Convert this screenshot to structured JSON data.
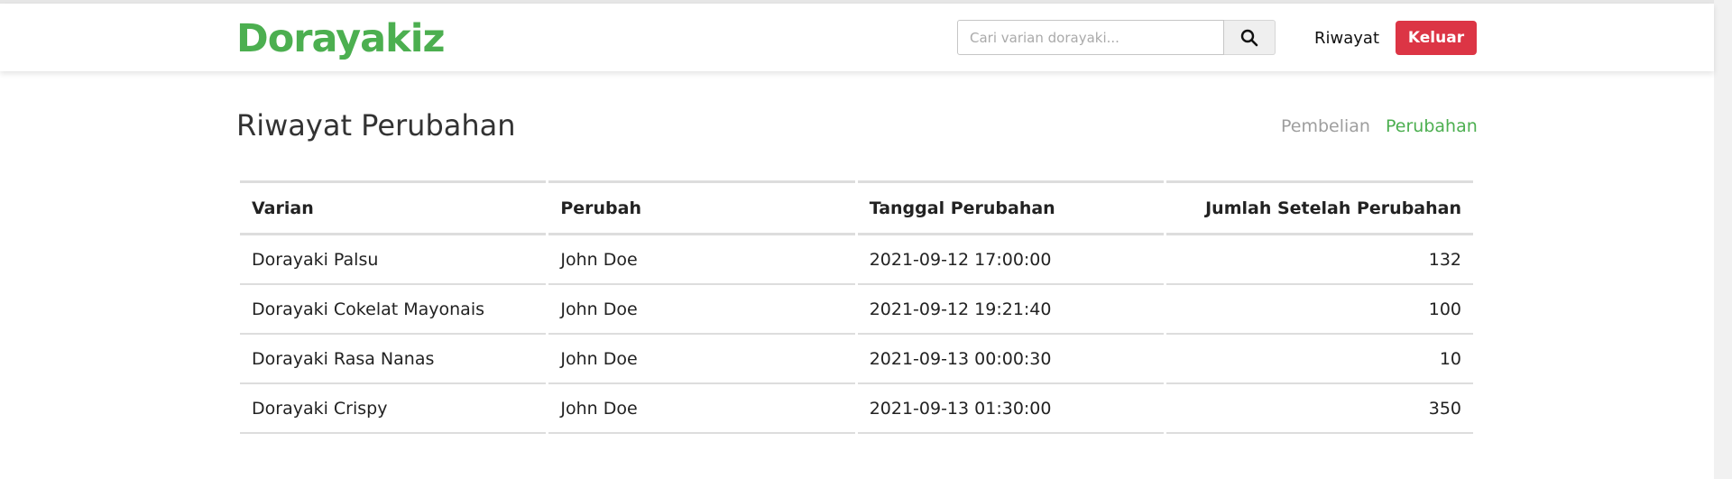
{
  "navbar": {
    "brand": "Dorayakiz",
    "search_placeholder": "Cari varian dorayaki...",
    "search_icon": "search-icon",
    "history_link": "Riwayat",
    "logout_label": "Keluar"
  },
  "page": {
    "title": "Riwayat Perubahan",
    "tabs": [
      {
        "label": "Pembelian",
        "active": false
      },
      {
        "label": "Perubahan",
        "active": true
      }
    ]
  },
  "table": {
    "headers": [
      "Varian",
      "Perubah",
      "Tanggal Perubahan",
      "Jumlah Setelah Perubahan"
    ],
    "rows": [
      [
        "Dorayaki Palsu",
        "John Doe",
        "2021-09-12 17:00:00",
        "132"
      ],
      [
        "Dorayaki Cokelat Mayonais",
        "John Doe",
        "2021-09-12 19:21:40",
        "100"
      ],
      [
        "Dorayaki Rasa Nanas",
        "John Doe",
        "2021-09-13 00:00:30",
        "10"
      ],
      [
        "Dorayaki Crispy",
        "John Doe",
        "2021-09-13 01:30:00",
        "350"
      ]
    ]
  },
  "colors": {
    "brand": "#4caf50",
    "danger": "#dc3545",
    "inactive_tab": "#9e9e9e"
  }
}
